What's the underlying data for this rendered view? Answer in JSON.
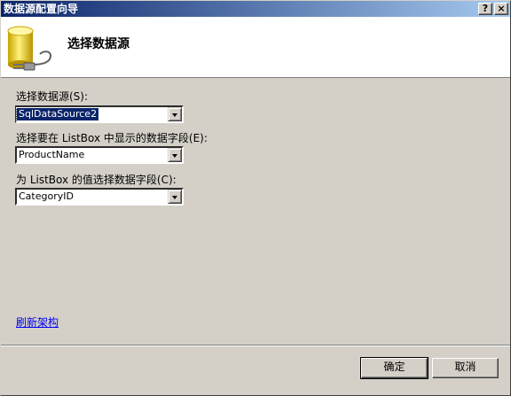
{
  "window": {
    "title": "数据源配置向导",
    "help_glyph": "?",
    "close_glyph": "×"
  },
  "header": {
    "title": "选择数据源",
    "icon": "database-plug-icon"
  },
  "form": {
    "datasource": {
      "label": "选择数据源(S):",
      "value": "SqlDataSource2"
    },
    "display_field": {
      "label": "选择要在 ListBox 中显示的数据字段(E):",
      "value": "ProductName"
    },
    "value_field": {
      "label": "为 ListBox 的值选择数据字段(C):",
      "value": "CategoryID"
    }
  },
  "refresh_link": "刷新架构",
  "buttons": {
    "ok": "确定",
    "cancel": "取消"
  },
  "colors": {
    "titlebar_start": "#0a246a",
    "titlebar_end": "#a6caf0",
    "dialog_bg": "#d4d0c8",
    "link": "#0000ee"
  }
}
